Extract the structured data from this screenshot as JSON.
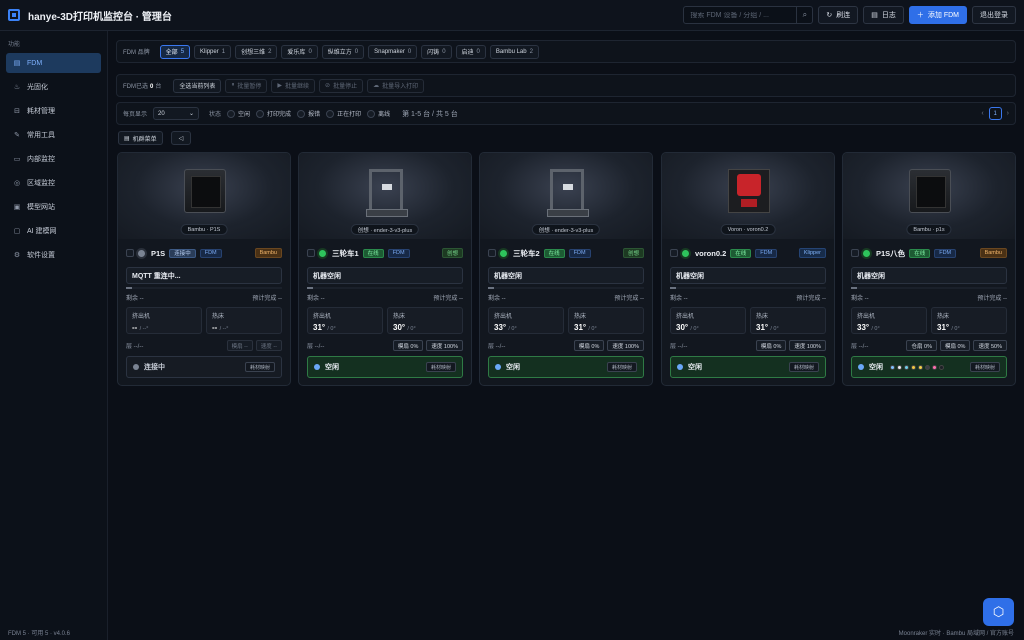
{
  "app": {
    "title": "hanye-3D打印机监控台 · 管理台"
  },
  "topbar": {
    "search_placeholder": "搜索 FDM 设备 / 分组 / ...",
    "refresh_label": "刷连",
    "log_label": "日志",
    "add_label": "添加 FDM",
    "logout_label": "退出登录"
  },
  "sidebar": {
    "heading": "功能",
    "items": [
      {
        "label": "FDM",
        "icon": "printer-icon",
        "glyph": "▤",
        "active": true
      },
      {
        "label": "光固化",
        "icon": "resin-icon",
        "glyph": "♨"
      },
      {
        "label": "耗材管理",
        "icon": "spool-icon",
        "glyph": "⊟"
      },
      {
        "label": "常用工具",
        "icon": "tool-icon",
        "glyph": "✎"
      },
      {
        "label": "内部监控",
        "icon": "monitor-icon",
        "glyph": "▭"
      },
      {
        "label": "区域监控",
        "icon": "location-icon",
        "glyph": "◎"
      },
      {
        "label": "模型网站",
        "icon": "model-icon",
        "glyph": "▣"
      },
      {
        "label": "AI 建模网",
        "icon": "ai-icon",
        "glyph": "▢"
      },
      {
        "label": "软件设置",
        "icon": "settings-icon",
        "glyph": "⚙"
      }
    ]
  },
  "brand_filter": {
    "label": "FDM 品牌",
    "chips": [
      {
        "name": "全部",
        "count": "5",
        "active": true
      },
      {
        "name": "Klipper",
        "count": "1"
      },
      {
        "name": "创想三维",
        "count": "2"
      },
      {
        "name": "爱乐库",
        "count": "0"
      },
      {
        "name": "纵维立方",
        "count": "0"
      },
      {
        "name": "Snapmaker",
        "count": "0"
      },
      {
        "name": "闪铸",
        "count": "0"
      },
      {
        "name": "启迪",
        "count": "0"
      },
      {
        "name": "Bambu Lab",
        "count": "2"
      }
    ]
  },
  "selection": {
    "prefix": "FDM已选",
    "count": "0",
    "unit": "台",
    "select_all": "全选当前列表",
    "actions": [
      {
        "label": "批量暂停",
        "icon": "pause-icon",
        "glyph": "⏸"
      },
      {
        "label": "批量继续",
        "icon": "play-icon",
        "glyph": "▶"
      },
      {
        "label": "批量停止",
        "icon": "stop-icon",
        "glyph": "⊘"
      },
      {
        "label": "批量导入打印",
        "icon": "cloud-upload-icon",
        "glyph": "☁"
      }
    ]
  },
  "filter": {
    "per_page_label": "每页显示",
    "per_page_value": "20",
    "state_label": "状态",
    "states": [
      "空闲",
      "打印完成",
      "报错",
      "正在打印",
      "离线"
    ],
    "page_info": "第 1-5 台 / 共 5 台",
    "current_page": "1"
  },
  "tools": {
    "group_label": "机群菜单"
  },
  "colors": {
    "accent": "#2f6fe8",
    "online": "#2ec45c",
    "idle_bg": "#143020"
  },
  "printers": [
    {
      "model_tag": "Bambu · P1S",
      "image": "bambu",
      "name": "P1S",
      "badge": "连接中",
      "badge_type": "conn",
      "dot_color": "#7a8392",
      "type": "FDM",
      "brand": "Bambu",
      "brand_type": "bambu",
      "message": "MQTT 重连中...",
      "progress": 0,
      "remaining": "剩余 --",
      "eta": "预计完成 --",
      "nozzle_label": "挤出机",
      "nozzle": "--",
      "nozzle_target": "/ --°",
      "bed_label": "热床",
      "bed": "--",
      "bed_target": "/ --°",
      "layer": "层 --/--",
      "pills": [
        "模扇 --",
        "速度 --"
      ],
      "pills_dim": true,
      "status": "连接中",
      "status_type": "conn",
      "status_btn": "耗材映射",
      "filaments": []
    },
    {
      "model_tag": "创想 · ender-3-v3-plus",
      "image": "ender",
      "name": "三轮车1",
      "badge": "在线",
      "badge_type": "online",
      "dot_color": "#2ec45c",
      "type": "FDM",
      "brand": "创想",
      "brand_type": "cb",
      "message": "机器空闲",
      "progress": 0,
      "remaining": "剩余 --",
      "eta": "预计完成 --",
      "nozzle_label": "挤出机",
      "nozzle": "31°",
      "nozzle_target": "/ 0°",
      "bed_label": "热床",
      "bed": "30°",
      "bed_target": "/ 0°",
      "layer": "层 --/--",
      "pills": [
        "模扇 0%",
        "速度 100%"
      ],
      "pills_dim": false,
      "status": "空闲",
      "status_type": "idle",
      "status_btn": "耗材映射",
      "filaments": []
    },
    {
      "model_tag": "创想 · ender-3-v3-plus",
      "image": "ender",
      "name": "三轮车2",
      "badge": "在线",
      "badge_type": "online",
      "dot_color": "#2ec45c",
      "type": "FDM",
      "brand": "创想",
      "brand_type": "cb",
      "message": "机器空闲",
      "progress": 0,
      "remaining": "剩余 --",
      "eta": "预计完成 --",
      "nozzle_label": "挤出机",
      "nozzle": "33°",
      "nozzle_target": "/ 0°",
      "bed_label": "热床",
      "bed": "31°",
      "bed_target": "/ 0°",
      "layer": "层 --/--",
      "pills": [
        "模扇 0%",
        "速度 100%"
      ],
      "pills_dim": false,
      "status": "空闲",
      "status_type": "idle",
      "status_btn": "耗材映射",
      "filaments": []
    },
    {
      "model_tag": "Voron · voron0.2",
      "image": "voron",
      "name": "voron0.2",
      "badge": "在线",
      "badge_type": "online",
      "dot_color": "#2ec45c",
      "type": "FDM",
      "brand": "Klipper",
      "brand_type": "klipper",
      "message": "机器空闲",
      "progress": 0,
      "remaining": "剩余 --",
      "eta": "预计完成 --",
      "nozzle_label": "挤出机",
      "nozzle": "30°",
      "nozzle_target": "/ 0°",
      "bed_label": "热床",
      "bed": "31°",
      "bed_target": "/ 0°",
      "layer": "层 --/--",
      "pills": [
        "模扇 0%",
        "速度 100%"
      ],
      "pills_dim": false,
      "status": "空闲",
      "status_type": "idle",
      "status_btn": "耗材映射",
      "filaments": []
    },
    {
      "model_tag": "Bambu · p1s",
      "image": "bambu",
      "name": "P1S八色",
      "badge": "在线",
      "badge_type": "online",
      "dot_color": "#2ec45c",
      "type": "FDM",
      "brand": "Bambu",
      "brand_type": "bambu",
      "message": "机器空闲",
      "progress": 0,
      "remaining": "剩余 --",
      "eta": "预计完成 --",
      "nozzle_label": "挤出机",
      "nozzle": "33°",
      "nozzle_target": "/ 0°",
      "bed_label": "热床",
      "bed": "31°",
      "bed_target": "/ 0°",
      "layer": "层 --/--",
      "pills": [
        "仓扇 0%",
        "模扇 0%",
        "速度 50%"
      ],
      "pills_dim": false,
      "status": "空闲",
      "status_type": "idle",
      "status_btn": "耗材映射",
      "filaments": [
        "#7fc3ff",
        "#e8ecef",
        "#6fd0e8",
        "#f1c842",
        "#f2d24b",
        "#3a3f46",
        "#ff6fb0",
        "#1c2026"
      ]
    }
  ],
  "footer": {
    "left": "FDM 5 · 可用 5 · v4.0.6",
    "right": "Moonraker 实时 · Bambu 局域网 / 官方账号"
  }
}
